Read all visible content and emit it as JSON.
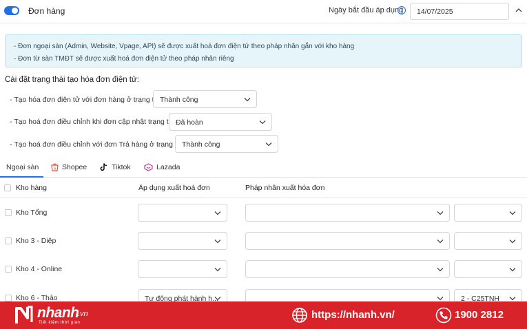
{
  "header": {
    "title": "Đơn hàng",
    "date_label": "Ngày bắt đầu áp dụng",
    "date_value": "14/07/2025"
  },
  "info": {
    "line1": "- Đơn ngoại sàn (Admin, Website, Vpage, API) sẽ được xuất hoá đơn điện tử theo pháp nhân gắn với kho hàng",
    "line2": "- Đơn từ sàn TMĐT sẽ được xuất hoá đơn điện tử theo pháp nhân riêng"
  },
  "settings": {
    "title": "Cài đặt trạng thái tạo hóa đơn điện tử:",
    "rules": [
      {
        "label": "- Tạo hóa đơn điện tử với đơn hàng ở trạng thái",
        "value": "Thành công"
      },
      {
        "label": "- Tạo hoá đơn điều chỉnh khi đơn cập nhật trạng thái",
        "value": "Đã hoàn"
      },
      {
        "label": "- Tạo hoá đơn điều chỉnh với đơn Trả hàng ở trạng thái",
        "value": "Thành công"
      }
    ]
  },
  "tabs": [
    {
      "label": "Ngoại sàn",
      "icon": "none"
    },
    {
      "label": "Shopee",
      "icon": "shopee-icon"
    },
    {
      "label": "Tiktok",
      "icon": "tiktok-icon"
    },
    {
      "label": "Lazada",
      "icon": "lazada-icon"
    }
  ],
  "table": {
    "headers": {
      "warehouse": "Kho hàng",
      "apply": "Áp dụng xuất hoá đơn",
      "entity": "Pháp nhân xuất hóa đơn"
    },
    "rows": [
      {
        "name": "Kho Tổng",
        "apply": "",
        "entity": "",
        "extra": ""
      },
      {
        "name": "Kho 3 - Diệp",
        "apply": "",
        "entity": "",
        "extra": ""
      },
      {
        "name": "Kho 4 - Online",
        "apply": "",
        "entity": "",
        "extra": ""
      },
      {
        "name": "Kho 6 - Thảo",
        "apply": "Tự động phát hành h...",
        "entity": "",
        "extra": "2 - C25TNH"
      }
    ]
  },
  "footer": {
    "logo": "nhanh",
    "logo_suffix": ".vn",
    "slogan": "Tiết kiệm thời gian",
    "website": "https://nhanh.vn/",
    "phone": "1900 2812"
  },
  "colors": {
    "accent": "#1e6fe8",
    "banner": "#d8232a",
    "info_bg": "#e5f5fa"
  }
}
